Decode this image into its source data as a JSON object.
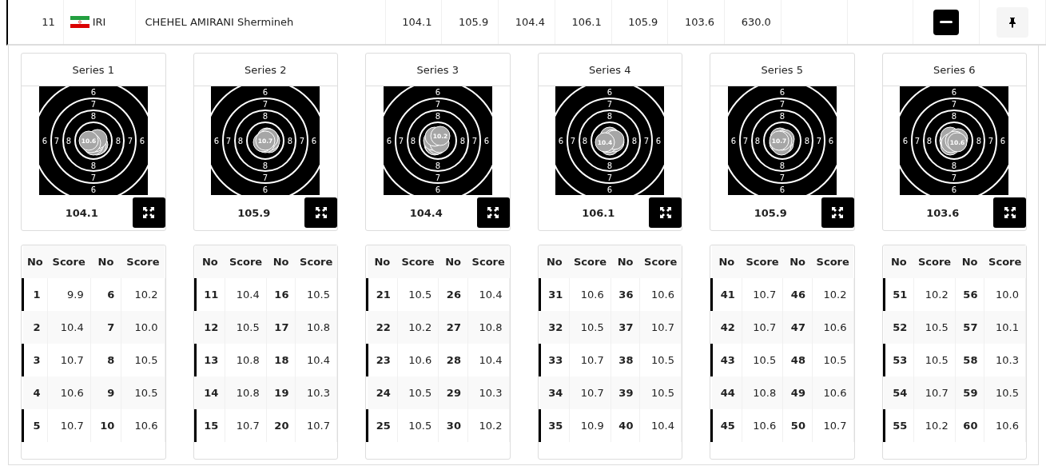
{
  "entry": {
    "rank": "11",
    "nation": "IRI",
    "name": "CHEHEL AMIRANI Shermineh",
    "series_scores": [
      "104.1",
      "105.9",
      "104.4",
      "106.1",
      "105.9",
      "103.6"
    ],
    "total": "630.0",
    "expanded": true
  },
  "series": [
    {
      "title": "Series 1",
      "total": "104.1",
      "target": {
        "ring_labels": [
          "6",
          "7",
          "8",
          "6",
          "7",
          "8",
          "8",
          "7",
          "6",
          "8",
          "7",
          "6"
        ],
        "shot_label": "10.6"
      },
      "table": {
        "columns": [
          "No",
          "Score",
          "No",
          "Score"
        ],
        "rows": [
          [
            "1",
            "9.9",
            "6",
            "10.2"
          ],
          [
            "2",
            "10.4",
            "7",
            "10.0"
          ],
          [
            "3",
            "10.7",
            "8",
            "10.5"
          ],
          [
            "4",
            "10.6",
            "9",
            "10.5"
          ],
          [
            "5",
            "10.7",
            "10",
            "10.6"
          ]
        ]
      }
    },
    {
      "title": "Series 2",
      "total": "105.9",
      "target": {
        "ring_labels": [
          "6",
          "7",
          "8",
          "6",
          "7",
          "8",
          "8",
          "7",
          "6",
          "8",
          "7",
          "6"
        ],
        "shot_label": "10.7"
      },
      "table": {
        "columns": [
          "No",
          "Score",
          "No",
          "Score"
        ],
        "rows": [
          [
            "11",
            "10.4",
            "16",
            "10.5"
          ],
          [
            "12",
            "10.5",
            "17",
            "10.8"
          ],
          [
            "13",
            "10.8",
            "18",
            "10.4"
          ],
          [
            "14",
            "10.8",
            "19",
            "10.3"
          ],
          [
            "15",
            "10.7",
            "20",
            "10.7"
          ]
        ]
      }
    },
    {
      "title": "Series 3",
      "total": "104.4",
      "target": {
        "ring_labels": [
          "6",
          "7",
          "8",
          "6",
          "7",
          "8",
          "8",
          "7",
          "6",
          "8",
          "7",
          "6"
        ],
        "shot_label": "10.2"
      },
      "table": {
        "columns": [
          "No",
          "Score",
          "No",
          "Score"
        ],
        "rows": [
          [
            "21",
            "10.5",
            "26",
            "10.4"
          ],
          [
            "22",
            "10.2",
            "27",
            "10.8"
          ],
          [
            "23",
            "10.6",
            "28",
            "10.4"
          ],
          [
            "24",
            "10.5",
            "29",
            "10.3"
          ],
          [
            "25",
            "10.5",
            "30",
            "10.2"
          ]
        ]
      }
    },
    {
      "title": "Series 4",
      "total": "106.1",
      "target": {
        "ring_labels": [
          "6",
          "7",
          "8",
          "6",
          "7",
          "8",
          "8",
          "7",
          "6",
          "8",
          "7",
          "6"
        ],
        "shot_label": "10.4"
      },
      "table": {
        "columns": [
          "No",
          "Score",
          "No",
          "Score"
        ],
        "rows": [
          [
            "31",
            "10.6",
            "36",
            "10.6"
          ],
          [
            "32",
            "10.5",
            "37",
            "10.7"
          ],
          [
            "33",
            "10.7",
            "38",
            "10.5"
          ],
          [
            "34",
            "10.7",
            "39",
            "10.5"
          ],
          [
            "35",
            "10.9",
            "40",
            "10.4"
          ]
        ]
      }
    },
    {
      "title": "Series 5",
      "total": "105.9",
      "target": {
        "ring_labels": [
          "6",
          "7",
          "8",
          "6",
          "7",
          "8",
          "8",
          "7",
          "6",
          "8",
          "7",
          "6"
        ],
        "shot_label": "10.7"
      },
      "table": {
        "columns": [
          "No",
          "Score",
          "No",
          "Score"
        ],
        "rows": [
          [
            "41",
            "10.7",
            "46",
            "10.2"
          ],
          [
            "42",
            "10.7",
            "47",
            "10.6"
          ],
          [
            "43",
            "10.5",
            "48",
            "10.5"
          ],
          [
            "44",
            "10.8",
            "49",
            "10.6"
          ],
          [
            "45",
            "10.6",
            "50",
            "10.7"
          ]
        ]
      }
    },
    {
      "title": "Series 6",
      "total": "103.6",
      "target": {
        "ring_labels": [
          "6",
          "7",
          "8",
          "6",
          "7",
          "8",
          "8",
          "7",
          "6",
          "8",
          "7",
          "6"
        ],
        "shot_label": "10.6"
      },
      "table": {
        "columns": [
          "No",
          "Score",
          "No",
          "Score"
        ],
        "rows": [
          [
            "51",
            "10.2",
            "56",
            "10.0"
          ],
          [
            "52",
            "10.5",
            "57",
            "10.1"
          ],
          [
            "53",
            "10.5",
            "58",
            "10.3"
          ],
          [
            "54",
            "10.7",
            "59",
            "10.5"
          ],
          [
            "55",
            "10.2",
            "60",
            "10.6"
          ]
        ]
      }
    }
  ]
}
